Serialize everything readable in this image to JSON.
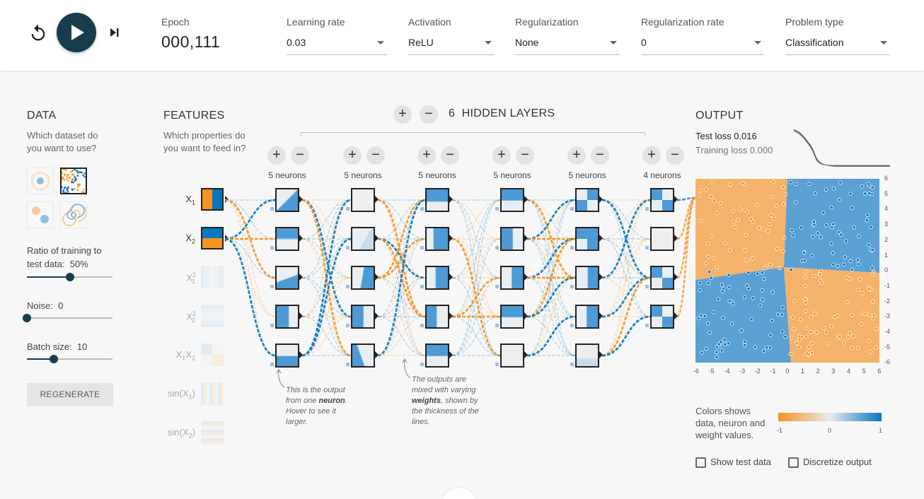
{
  "header": {
    "epoch_label": "Epoch",
    "epoch_value": "000,111",
    "learning_rate": {
      "label": "Learning rate",
      "value": "0.03"
    },
    "activation": {
      "label": "Activation",
      "value": "ReLU"
    },
    "regularization": {
      "label": "Regularization",
      "value": "None"
    },
    "regularization_rate": {
      "label": "Regularization rate",
      "value": "0"
    },
    "problem_type": {
      "label": "Problem type",
      "value": "Classification"
    }
  },
  "data": {
    "title": "DATA",
    "subtitle": "Which dataset do you want to use?",
    "datasets": [
      "circle",
      "xor",
      "gaussian",
      "spiral"
    ],
    "selected_dataset": "xor",
    "ratio_label": "Ratio of training to test data:",
    "ratio_value": "50%",
    "ratio": 0.5,
    "noise_label": "Noise:",
    "noise_value": "0",
    "noise": 0,
    "batch_label": "Batch size:",
    "batch_value": "10",
    "batch": 10,
    "regenerate_label": "REGENERATE"
  },
  "features": {
    "title": "FEATURES",
    "subtitle": "Which properties do you want to feed in?",
    "items": [
      {
        "base": "X",
        "sub": "1",
        "sup": "",
        "active": true
      },
      {
        "base": "X",
        "sub": "2",
        "sup": "",
        "active": true
      },
      {
        "base": "X",
        "sub": "1",
        "sup": "2",
        "active": false
      },
      {
        "base": "X",
        "sub": "2",
        "sup": "2",
        "active": false
      },
      {
        "base": "X",
        "sub": "1",
        "base2": "X",
        "sub2": "2",
        "active": false
      },
      {
        "base": "sin(X",
        "sub": "1",
        "tail": ")",
        "active": false
      },
      {
        "base": "sin(X",
        "sub": "2",
        "tail": ")",
        "active": false
      }
    ]
  },
  "network": {
    "count": "6",
    "title": "HIDDEN LAYERS",
    "plus": "+",
    "minus": "−",
    "layers": [
      {
        "label": "5 neurons",
        "neurons": 5
      },
      {
        "label": "5 neurons",
        "neurons": 5
      },
      {
        "label": "5 neurons",
        "neurons": 5
      },
      {
        "label": "5 neurons",
        "neurons": 5
      },
      {
        "label": "5 neurons",
        "neurons": 5
      },
      {
        "label": "4 neurons",
        "neurons": 4
      }
    ],
    "note1_pre": "This is the output from one ",
    "note1_bold": "neuron",
    "note1_post": ". Hover to see it larger.",
    "note2_pre": "The outputs are mixed with varying ",
    "note2_bold": "weights",
    "note2_post": ", shown by the thickness of the lines."
  },
  "output": {
    "title": "OUTPUT",
    "test_loss_label": "Test loss",
    "test_loss": "0.016",
    "train_loss_label": "Training loss",
    "train_loss": "0.000",
    "x_ticks": [
      "-6",
      "-5",
      "-4",
      "-3",
      "-2",
      "-1",
      "0",
      "1",
      "2",
      "3",
      "4",
      "5",
      "6"
    ],
    "y_ticks": [
      "6",
      "5",
      "4",
      "3",
      "2",
      "1",
      "0",
      "-1",
      "-2",
      "-3",
      "-4",
      "-5",
      "-6"
    ],
    "legend_text": "Colors shows data, neuron and weight values.",
    "legend_min": "-1",
    "legend_mid": "0",
    "legend_max": "1",
    "show_test_label": "Show test data",
    "discretize_label": "Discretize output",
    "colors": {
      "orange": "#f59322",
      "blue": "#0877bd",
      "dark": "#183d4e"
    }
  }
}
